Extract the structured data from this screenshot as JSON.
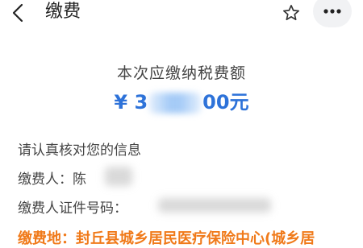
{
  "header": {
    "title": "缴费",
    "back_icon": "chevron-left-icon",
    "star_icon": "star-outline-icon",
    "more_icon": "more-horizontal-icon"
  },
  "amount": {
    "label": "本次应缴纳税费额",
    "currency": "¥",
    "prefix": "3",
    "suffix": "00元",
    "color": "#2d72d9"
  },
  "info": {
    "section_title": "请认真核对您的信息",
    "payee_label": "缴费人：",
    "payee_value": "陈",
    "id_label": "缴费人证件号码：",
    "place": "缴费地：封丘县城乡居民医疗保险中心(城乡居"
  },
  "colors": {
    "accent": "#2d72d9",
    "warning": "#f07a1a"
  }
}
